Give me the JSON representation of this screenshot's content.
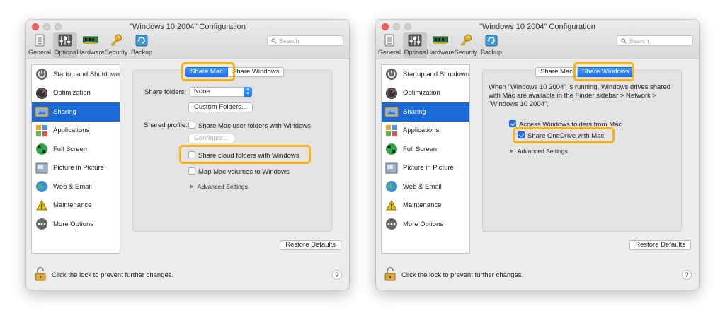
{
  "colors": {
    "accent": "#1a69d6",
    "highlight": "#f7b41a",
    "close_button": "#fc5f57"
  },
  "left": {
    "title": "\"Windows 10 2004\" Configuration",
    "toolbar": [
      {
        "label": "General",
        "icon": "general-icon"
      },
      {
        "label": "Options",
        "icon": "options-icon"
      },
      {
        "label": "Hardware",
        "icon": "hardware-icon"
      },
      {
        "label": "Security",
        "icon": "security-key-icon"
      },
      {
        "label": "Backup",
        "icon": "backup-icon"
      }
    ],
    "search_placeholder": "Search",
    "sidebar": [
      "Startup and Shutdown",
      "Optimization",
      "Sharing",
      "Applications",
      "Full Screen",
      "Picture in Picture",
      "Web & Email",
      "Maintenance",
      "More Options"
    ],
    "tabs": [
      "Share Mac",
      "Share Windows"
    ],
    "share_folders_label": "Share folders:",
    "share_folders_value": "None",
    "custom_folders": "Custom Folders...",
    "shared_profile_label": "Shared profile:",
    "share_user_folders": "Share Mac user folders with Windows",
    "configure": "Configure...",
    "share_cloud": "Share cloud folders with Windows",
    "map_volumes": "Map Mac volumes to Windows",
    "advanced": "Advanced Settings",
    "restore": "Restore Defaults",
    "lock_text": "Click the lock to prevent further changes.",
    "help": "?"
  },
  "right": {
    "title": "\"Windows 10 2004\" Configuration",
    "toolbar": [
      {
        "label": "General",
        "icon": "general-icon"
      },
      {
        "label": "Options",
        "icon": "options-icon"
      },
      {
        "label": "Hardware",
        "icon": "hardware-icon"
      },
      {
        "label": "Security",
        "icon": "security-key-icon"
      },
      {
        "label": "Backup",
        "icon": "backup-icon"
      }
    ],
    "search_placeholder": "Search",
    "sidebar": [
      "Startup and Shutdown",
      "Optimization",
      "Sharing",
      "Applications",
      "Full Screen",
      "Picture in Picture",
      "Web & Email",
      "Maintenance",
      "More Options"
    ],
    "tabs": [
      "Share Mac",
      "Share Windows"
    ],
    "description": "When \"Windows 10 2004\" is running, Windows drives shared with Mac are available in the Finder sidebar > Network > \"Windows 10 2004\".",
    "access_windows": "Access Windows folders from Mac",
    "share_onedrive": "Share OneDrive with Mac",
    "advanced": "Advanced Settings",
    "restore": "Restore Defaults",
    "lock_text": "Click the lock to prevent further changes.",
    "help": "?"
  }
}
